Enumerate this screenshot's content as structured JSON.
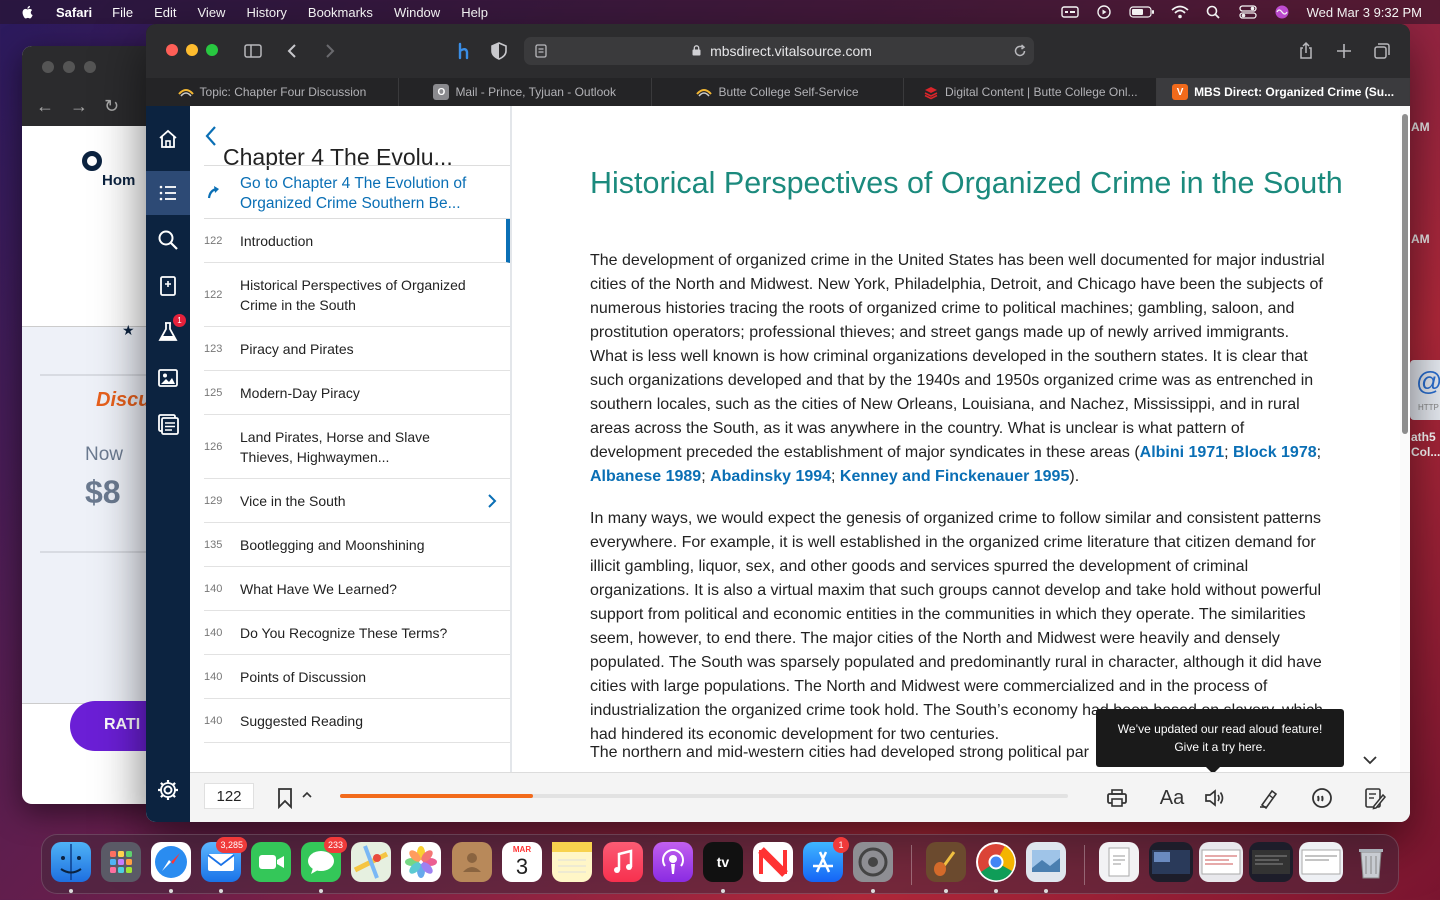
{
  "menubar": {
    "app": "Safari",
    "items": [
      "File",
      "Edit",
      "View",
      "History",
      "Bookmarks",
      "Window",
      "Help"
    ],
    "clock": "Wed Mar 3  9:32 PM"
  },
  "background_window": {
    "home_label": "Hom",
    "discount_label": "Discu",
    "now_label": "Now",
    "price": "$8",
    "rate_label": "RATI",
    "right_am_1": "AM",
    "right_am_2": "AM",
    "right_at": "@",
    "right_http": "HTTP",
    "right_math": "ath5",
    "right_col": "Col..."
  },
  "browser": {
    "url": "mbsdirect.vitalsource.com",
    "tabs": [
      {
        "label": "Topic: Chapter Four Discussion",
        "icon": "butte-college-icon"
      },
      {
        "label": "Mail - Prince, Tyjuan - Outlook",
        "icon": "outlook-icon"
      },
      {
        "label": "Butte College Self-Service",
        "icon": "butte-college-icon"
      },
      {
        "label": "Digital Content | Butte College Onl...",
        "icon": "book-stack-icon"
      },
      {
        "label": "MBS Direct: Organized Crime (Su...",
        "icon": "vitalsource-icon"
      }
    ]
  },
  "toc": {
    "chapter_title": "Chapter 4 The Evolu...",
    "goto_label": "Go to Chapter 4 The Evolution of Organized Crime Southern Be...",
    "items": [
      {
        "page": "122",
        "label": "Introduction"
      },
      {
        "page": "122",
        "label": "Historical Perspectives of Organized Crime in the South"
      },
      {
        "page": "123",
        "label": "Piracy and Pirates"
      },
      {
        "page": "125",
        "label": "Modern-Day Piracy"
      },
      {
        "page": "126",
        "label": "Land Pirates, Horse and Slave Thieves, Highwaymen..."
      },
      {
        "page": "129",
        "label": "Vice in the South"
      },
      {
        "page": "135",
        "label": "Bootlegging and Moonshining"
      },
      {
        "page": "140",
        "label": "What Have We Learned?"
      },
      {
        "page": "140",
        "label": "Do You Recognize These Terms?"
      },
      {
        "page": "140",
        "label": "Points of Discussion"
      },
      {
        "page": "140",
        "label": "Suggested Reading"
      }
    ]
  },
  "reader": {
    "heading": "Historical Perspectives of Organized Crime in the South",
    "para1": "The development of organized crime in the United States has been well documented for major industrial cities of the North and Midwest. New York, Philadelphia, Detroit, and Chicago have been the subjects of numerous histories tracing the roots of organized crime to political machines; gambling, saloon, and prostitution operators; professional thieves; and street gangs made up of newly arrived immigrants. What is less well known is how criminal organizations developed in the southern states. It is clear that such organizations developed and that by the 1940s and 1950s organized crime was as entrenched in southern locales, such as the cities of New Orleans, Louisiana, and Nachez, Mississippi, and in rural areas across the South, as it was anywhere in the country. What is unclear is what pattern of development preceded the establishment of major syndicates in these areas (",
    "citations": [
      "Albini 1971",
      "Block 1978",
      "Albanese 1989",
      "Abadinsky 1994",
      "Kenney and Finckenauer 1995"
    ],
    "cite_sep": "; ",
    "para1_end": ").",
    "para2": "In many ways, we would expect the genesis of organized crime to follow similar and consistent patterns everywhere. For example, it is well established in the organized crime literature that citizen demand for illicit gambling, liquor, sex, and other goods and services spurred the development of criminal organizations. It is also a virtual maxim that such groups cannot develop and take hold without powerful support from political and economic entities in the communities in which they operate. The similarities seem, however, to end there. The major cities of the North and Midwest were heavily and densely populated. The South was sparsely populated and predominantly rural in character, although it did have cities with large populations. The North and Midwest were commercialized and in the process of industrialization the organized crime took hold. The South’s economy had been based on slavery, which had hindered its economic development for two centuries.",
    "para3": "The northern and mid-western cities had developed strong political par",
    "tooltip_line1": "We’ve updated our read aloud feature!",
    "tooltip_line2": "Give it a try here."
  },
  "bottombar": {
    "page": "122",
    "progress": 0.265,
    "accent": "#f26a1b"
  },
  "dock": {
    "mail_badge": "3,285",
    "messages_badge": "233",
    "appstore_badge": "1",
    "calendar_month": "MAR",
    "calendar_day": "3",
    "tv_label": "tv",
    "rail_badge": "1"
  },
  "colors": {
    "rail": "#0c2340",
    "heading": "#1b8a7d",
    "link": "#0a6fb5"
  }
}
